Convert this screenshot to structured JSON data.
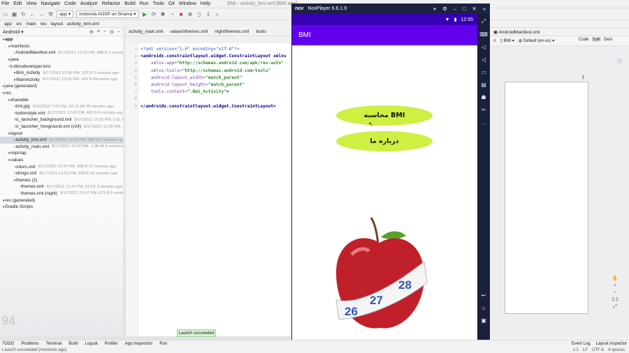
{
  "menubar": {
    "items": [
      "File",
      "Edit",
      "View",
      "Navigate",
      "Code",
      "Analyze",
      "Refactor",
      "Build",
      "Run",
      "Tools",
      "Git",
      "Window",
      "Help"
    ],
    "window_title": "BMI - activity_bmi.xml [BMI.app]"
  },
  "toolbar": {
    "module": "app",
    "device": "motorola AOSP on Shama"
  },
  "breadcrumb": [
    "app",
    "src",
    "main",
    "res",
    "layout",
    "activity_bmi.xml"
  ],
  "project": {
    "view": "Android"
  },
  "tree": [
    {
      "indent": 0,
      "label": "app",
      "meta": "",
      "bold": true
    },
    {
      "indent": 1,
      "label": "manifests",
      "meta": ""
    },
    {
      "indent": 2,
      "label": "AndroidManifest.xml",
      "meta": "8/17/2021 12:53 PM, 888 B 2 minutes ago"
    },
    {
      "indent": 1,
      "label": "java",
      "meta": ""
    },
    {
      "indent": 1,
      "label": "ir.dimodeveloper.bmi",
      "meta": ""
    },
    {
      "indent": 2,
      "label": "Bmi_Activity",
      "meta": "8/17/2021 12:30 PM, 332 B 5 minutes ago"
    },
    {
      "indent": 2,
      "label": "MainActivity",
      "meta": "8/17/2021 12:55 PM, 993 B Moments ago"
    },
    {
      "indent": 0,
      "label": "java (generated)",
      "meta": ""
    },
    {
      "indent": 0,
      "label": "res",
      "meta": ""
    },
    {
      "indent": 1,
      "label": "drawable",
      "meta": ""
    },
    {
      "indent": 2,
      "label": "bmi.jpg",
      "meta": "9/11/2018 7:42 PM, 43.15 kB 20 minutes ago"
    },
    {
      "indent": 2,
      "label": "buttonstyle.xml",
      "meta": "8/17/2021 12:43 PM, 465 B 6 minutes ago"
    },
    {
      "indent": 2,
      "label": "ic_launcher_background.xml",
      "meta": "8/17/2021 12:26 PM, 5.61 kB"
    },
    {
      "indent": 2,
      "label": "ic_launcher_foreground.xml (v24)",
      "meta": "8/17/2021 12:26 PM, 1"
    },
    {
      "indent": 1,
      "label": "layout",
      "meta": ""
    },
    {
      "indent": 2,
      "label": "activity_bmi.xml",
      "meta": "8/17/2021 12:53 PM, 405 B 2 minutes ago",
      "sel": true
    },
    {
      "indent": 2,
      "label": "activity_main.xml",
      "meta": "8/17/2021 12:49 PM, 1.08 kB 6 minutes ago"
    },
    {
      "indent": 1,
      "label": "mipmap",
      "meta": ""
    },
    {
      "indent": 1,
      "label": "values",
      "meta": ""
    },
    {
      "indent": 2,
      "label": "colors.xml",
      "meta": "8/17/2021 12:47 PM, 488 B 12 minutes ago"
    },
    {
      "indent": 2,
      "label": "strings.xml",
      "meta": "8/17/2021 12:53 PM, 168 B 24 minutes ago"
    },
    {
      "indent": 2,
      "label": "themes (2)",
      "meta": ""
    },
    {
      "indent": 3,
      "label": "themes.xml",
      "meta": "8/17/2021 12:47 PM, 613 B 9 minutes ago"
    },
    {
      "indent": 3,
      "label": "themes.xml (night)",
      "meta": "8/17/2021 12:47 PM, 811 B 8 minutes ago"
    },
    {
      "indent": 0,
      "label": "res (generated)",
      "meta": ""
    },
    {
      "indent": 0,
      "label": "Gradle Scripts",
      "meta": ""
    }
  ],
  "editor_tabs": [
    "activity_main.xml",
    "values\\themes.xml",
    "night\\themes.xml",
    "butto"
  ],
  "code_lines": [
    {
      "n": "1",
      "parts": [
        [
          "pi",
          "<?xml version=\"1.0\" encoding=\"utf-8\"?>"
        ]
      ]
    },
    {
      "n": "2",
      "parts": [
        [
          "tag",
          "<androidx.constraintlayout.widget.ConstraintLayout xmlns"
        ]
      ]
    },
    {
      "n": "3",
      "parts": [
        [
          "attr",
          "    xmlns:app="
        ],
        [
          "val",
          "\"http://schemas.android.com/apk/res-auto\""
        ]
      ]
    },
    {
      "n": "4",
      "parts": [
        [
          "attr",
          "    xmlns:tools="
        ],
        [
          "val",
          "\"http://schemas.android.com/tools\""
        ]
      ]
    },
    {
      "n": "5",
      "parts": [
        [
          "attr",
          "    android:layout_width="
        ],
        [
          "val",
          "\"match_parent\""
        ]
      ]
    },
    {
      "n": "6",
      "parts": [
        [
          "attr",
          "    android:layout_height="
        ],
        [
          "val",
          "\"match_parent\""
        ]
      ]
    },
    {
      "n": "7",
      "parts": [
        [
          "attr",
          "    tools:context="
        ],
        [
          "val",
          "\".Bmi_Activity\""
        ],
        [
          "tag",
          ">"
        ]
      ]
    },
    {
      "n": "8",
      "parts": []
    },
    {
      "n": "9",
      "parts": [
        [
          "tag",
          "</androidx.constraintlayout.widget.ConstraintLayout>"
        ]
      ]
    }
  ],
  "emulator": {
    "title": "NoxPlayer 6.6.1.9",
    "logo": "nox",
    "time": "12:55",
    "app_title": "BMI",
    "button1": "محاسبه BMI",
    "button2": "درباره ما",
    "tape_numbers": [
      "26",
      "27",
      "28"
    ]
  },
  "right_panel": {
    "tab": "AndroidManifest.xml",
    "views": [
      "Code",
      "Split",
      "Desi"
    ],
    "device": "BMI",
    "locale": "Default (en-us)"
  },
  "bottom_tabs": [
    "TODO",
    "Problems",
    "Terminal",
    "Build",
    "Logcat",
    "Profiler",
    "App Inspection",
    "Run"
  ],
  "bottom_right": [
    "Event Log",
    "Layout Inspector"
  ],
  "status": {
    "text": "Launch succeeded (moments ago)",
    "right": [
      "1:1",
      "LF",
      "UTF-8",
      "4 spaces"
    ]
  },
  "toast": "Launch succeeded",
  "watermark": "94",
  "colors": {
    "app_bar": "#6200ee",
    "status_bar": "#3700b3",
    "button": "#cdf042"
  }
}
